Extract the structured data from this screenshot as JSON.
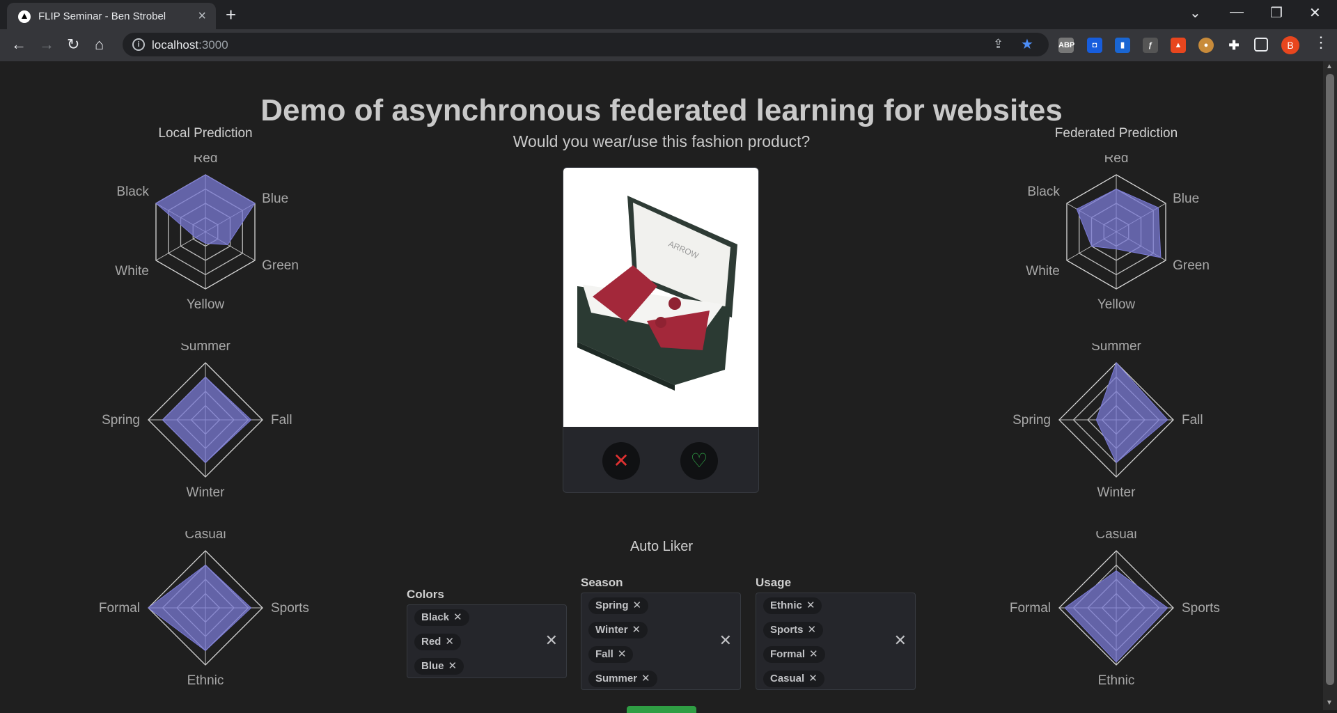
{
  "browser": {
    "tab_title": "FLIP Seminar - Ben Strobel",
    "url_host": "localhost",
    "url_port": ":3000",
    "avatar_letter": "B",
    "extensions": [
      "abp-icon",
      "bitwarden-icon",
      "trello-icon",
      "script-icon",
      "rocket-icon",
      "cookie-icon",
      "puzzle-icon",
      "sidepanel-icon"
    ]
  },
  "page": {
    "title": "Demo of asynchronous federated learning for websites",
    "subtitle": "Would you wear/use this fashion product?"
  },
  "local": {
    "title": "Local Prediction",
    "colors_labels": [
      "Red",
      "Blue",
      "Green",
      "Yellow",
      "White",
      "Black"
    ],
    "colors_values": [
      1.0,
      1.0,
      0.45,
      0.2,
      0.2,
      1.0
    ],
    "season_labels": [
      "Summer",
      "Fall",
      "Winter",
      "Spring"
    ],
    "season_values": [
      0.75,
      0.8,
      0.75,
      0.75
    ],
    "usage_labels": [
      "Casual",
      "Sports",
      "Ethnic",
      "Formal"
    ],
    "usage_values": [
      0.75,
      0.8,
      0.75,
      1.0
    ]
  },
  "federated": {
    "title": "Federated Prediction",
    "colors_labels": [
      "Red",
      "Blue",
      "Green",
      "Yellow",
      "White",
      "Black"
    ],
    "colors_values": [
      0.75,
      0.85,
      0.9,
      0.3,
      0.5,
      0.8
    ],
    "season_labels": [
      "Summer",
      "Fall",
      "Winter",
      "Spring"
    ],
    "season_values": [
      1.0,
      0.9,
      0.75,
      0.35
    ],
    "usage_labels": [
      "Casual",
      "Sports",
      "Ethnic",
      "Formal"
    ],
    "usage_values": [
      0.65,
      0.9,
      0.95,
      0.9
    ]
  },
  "product": {
    "description_icons": [
      "dislike-icon",
      "like-icon"
    ]
  },
  "autoliker": {
    "title": "Auto Liker",
    "colors": {
      "label": "Colors",
      "selected": [
        "Black",
        "Red",
        "Blue"
      ]
    },
    "season": {
      "label": "Season",
      "selected": [
        "Spring",
        "Winter",
        "Fall",
        "Summer"
      ]
    },
    "usage": {
      "label": "Usage",
      "selected": [
        "Ethnic",
        "Sports",
        "Formal",
        "Casual"
      ]
    }
  },
  "colors": {
    "radar_fill": "#7b7bd6",
    "accent_green": "#2f9e44",
    "dislike_red": "#e03131",
    "like_green": "#2f9e44"
  }
}
